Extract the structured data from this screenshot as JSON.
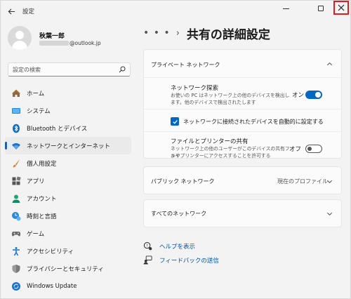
{
  "window": {
    "title": "設定",
    "back_icon": "arrow-left-icon",
    "minimize_icon": "minimize-icon",
    "maximize_icon": "maximize-icon",
    "close_icon": "close-icon",
    "close_highlight_color": "#e01b1b"
  },
  "profile": {
    "name": "秋葉一郎",
    "email_suffix": "@outlook.jp"
  },
  "search": {
    "placeholder": "設定の検索",
    "icon": "search-icon"
  },
  "sidebar": {
    "selected_accent": "#0067c0",
    "items": [
      {
        "label": "ホーム",
        "icon": "home-icon",
        "selected": false
      },
      {
        "label": "システム",
        "icon": "system-display-icon",
        "selected": false
      },
      {
        "label": "Bluetooth とデバイス",
        "icon": "bluetooth-icon",
        "selected": false
      },
      {
        "label": "ネットワークとインターネット",
        "icon": "wifi-icon",
        "selected": true
      },
      {
        "label": "個人用設定",
        "icon": "paint-brush-icon",
        "selected": false
      },
      {
        "label": "アプリ",
        "icon": "apps-icon",
        "selected": false
      },
      {
        "label": "アカウント",
        "icon": "account-icon",
        "selected": false
      },
      {
        "label": "時刻と言語",
        "icon": "time-language-icon",
        "selected": false
      },
      {
        "label": "ゲーム",
        "icon": "gamepad-icon",
        "selected": false
      },
      {
        "label": "アクセシビリティ",
        "icon": "accessibility-icon",
        "selected": false
      },
      {
        "label": "プライバシーとセキュリティ",
        "icon": "shield-icon",
        "selected": false
      },
      {
        "label": "Windows Update",
        "icon": "windows-update-icon",
        "selected": false
      }
    ]
  },
  "header": {
    "breadcrumb_more": "• • •",
    "breadcrumb_separator": "›",
    "title": "共有の詳細設定"
  },
  "private_network": {
    "title": "プライベート ネットワーク",
    "expanded": true,
    "discovery": {
      "title": "ネットワーク探索",
      "description_1": "お使いの PC はネットワーク上の他のデバイスを検出し",
      "description_2": "ます。他のデバイスで検出されたします",
      "state_label": "オン",
      "on": true
    },
    "auto_setup": {
      "label": "ネットワークに接続されたデバイスを自動的に設定する",
      "checked": true
    },
    "file_sharing": {
      "title": "ファイルとプリンターの共有",
      "description_1": "ネットワーク上の他のユーザーがこのデバイスの共有ファイ",
      "description_2": "ルやプリンターにアクセスすることを許可する",
      "state_label": "オフ",
      "on": false
    }
  },
  "public_network": {
    "title": "パブリック ネットワーク",
    "status": "現在のプロファイル",
    "expanded": false
  },
  "all_networks": {
    "title": "すべてのネットワーク",
    "expanded": false
  },
  "links": {
    "help": {
      "label": "ヘルプを表示",
      "icon": "help-icon"
    },
    "feedback": {
      "label": "フィードバックの送信",
      "icon": "feedback-icon"
    }
  },
  "colors": {
    "accent": "#0067c0",
    "link": "#0050a0",
    "background": "#f3f3f3",
    "card": "#fbfbfb"
  }
}
